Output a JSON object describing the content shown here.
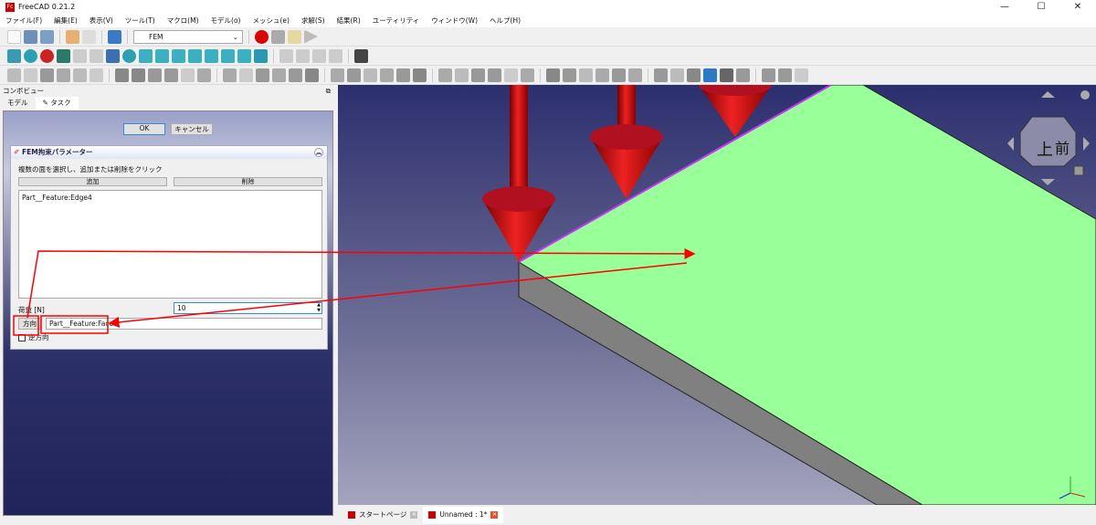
{
  "app": {
    "title": "FreeCAD 0.21.2"
  },
  "window_controls": {
    "minimize": "—",
    "maximize": "☐",
    "close": "✕"
  },
  "menu": [
    "ファイル(F)",
    "編集(E)",
    "表示(V)",
    "ツール(T)",
    "マクロ(M)",
    "モデル(o)",
    "メッシュ(e)",
    "求解(S)",
    "結果(R)",
    "ユーティリティ",
    "ウィンドウ(W)",
    "ヘルプ(H)"
  ],
  "toolbar": {
    "workbench": "FEM"
  },
  "combo_view": {
    "title": "コンボビュー",
    "tabs": [
      "モデル",
      "タスク"
    ],
    "active_tab": "タスク"
  },
  "task": {
    "ok": "OK",
    "cancel": "キャンセル",
    "panel_title": "FEM拘束パラメーター",
    "instruction": "複数の面を選択し、追加または削除をクリック",
    "add": "追加",
    "remove": "削除",
    "references": [
      "Part__Feature:Edge4"
    ],
    "load_label": "荷重 [N]",
    "load_value": "10",
    "direction_button": "方向",
    "direction_value": "Part__Feature:Face4",
    "reverse_label": "逆方向",
    "reverse_checked": false
  },
  "navcube": {
    "top": "上",
    "front": "前"
  },
  "doc_tabs": [
    {
      "label": "スタートページ",
      "active": false
    },
    {
      "label": "Unnamed : 1*",
      "active": true
    }
  ],
  "colors": {
    "face": "#99ff99",
    "arrow": "#cc1122",
    "annotation": "#ff0000",
    "edge_highlight": "#cc33ff"
  }
}
